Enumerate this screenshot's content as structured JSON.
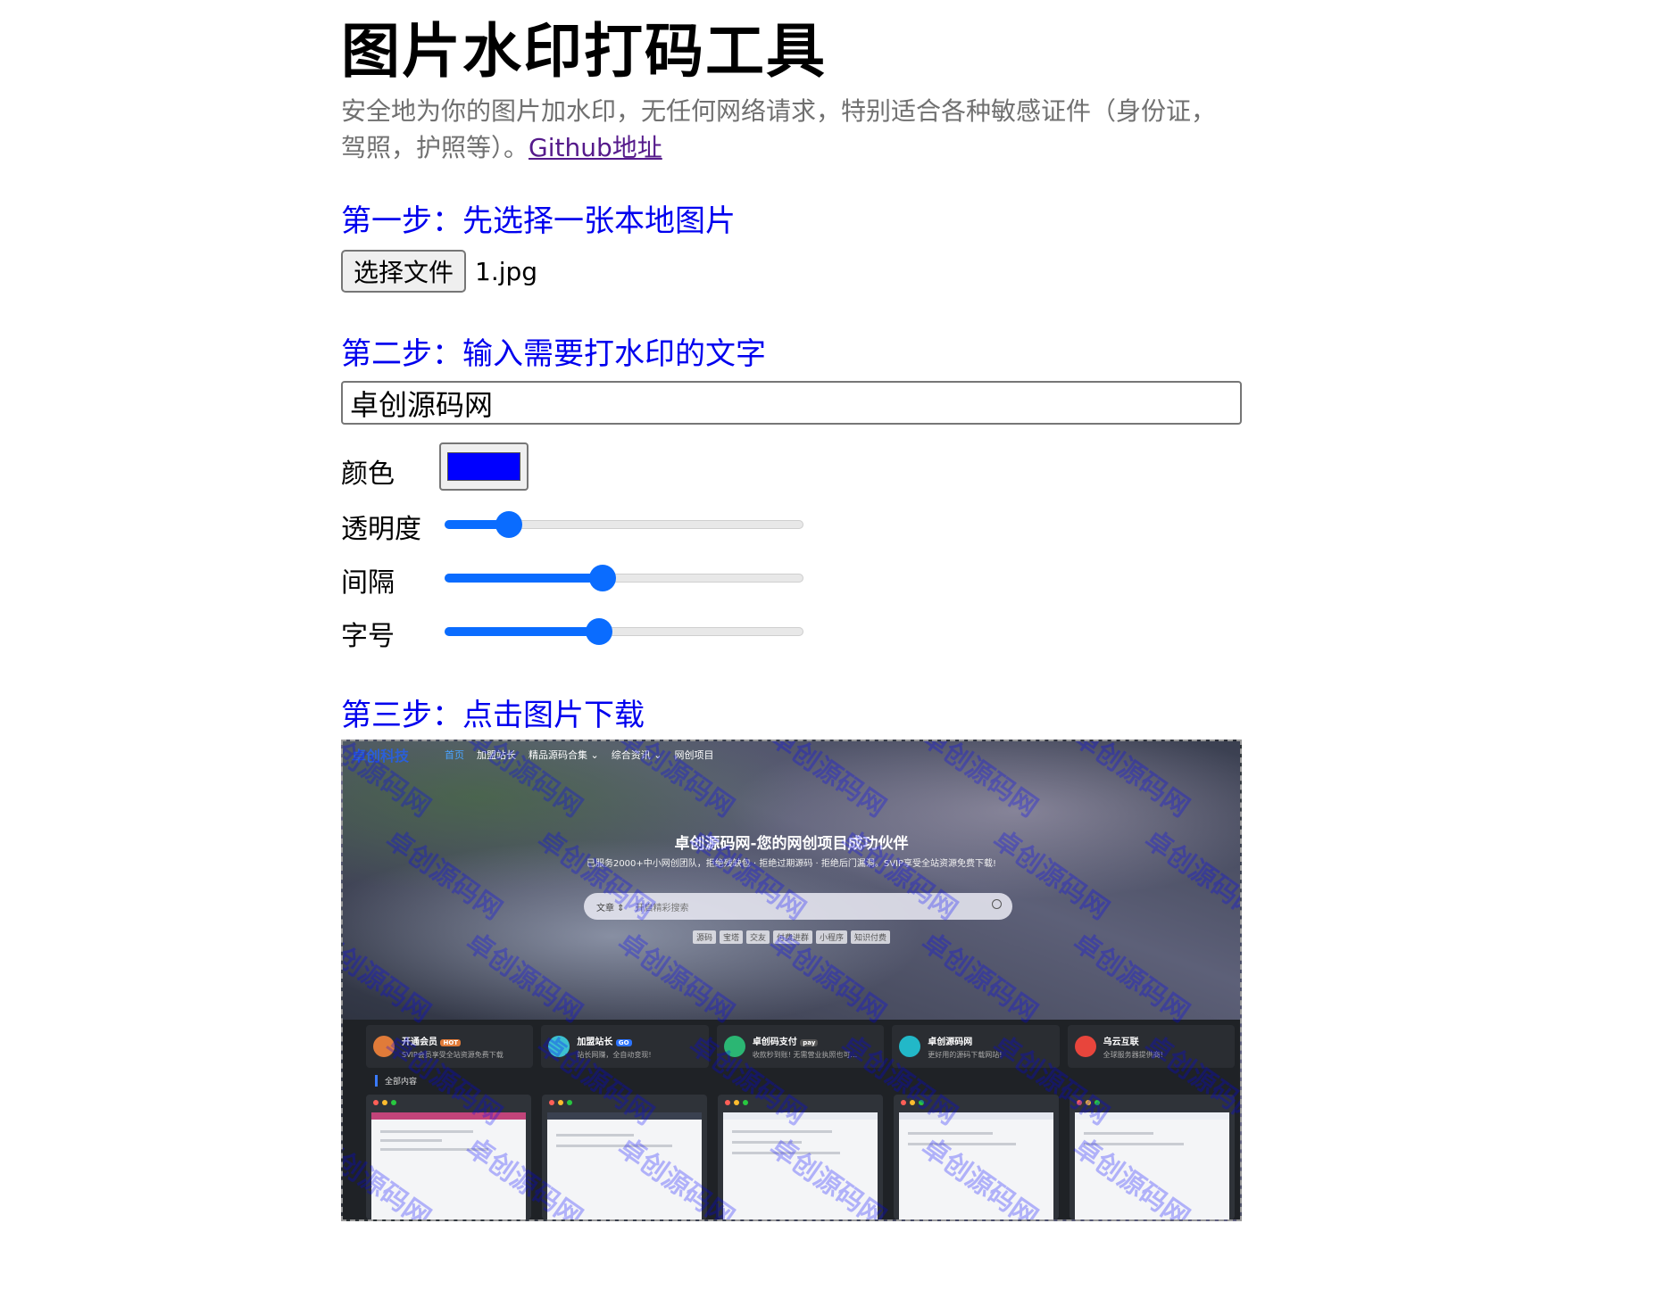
{
  "header": {
    "title": "图片水印打码工具",
    "description": "安全地为你的图片加水印，无任何网络请求，特别适合各种敏感证件（身份证，驾照，护照等）。",
    "github_link": "Github地址"
  },
  "step1": {
    "heading": "第一步：先选择一张本地图片",
    "choose_button": "选择文件",
    "file_name": "1.jpg"
  },
  "step2": {
    "heading": "第二步：输入需要打水印的文字",
    "watermark_text": "卓创源码网",
    "color_label": "颜色",
    "color_value": "#0000ff",
    "opacity_label": "透明度",
    "opacity_value": 0.18,
    "spacing_label": "间隔",
    "spacing_value": 0.44,
    "fontsize_label": "字号",
    "fontsize_value": 0.43
  },
  "step3": {
    "heading": "第三步：点击图片下载"
  },
  "preview": {
    "logo": "卓创科技",
    "nav": [
      "首页",
      "加盟站长",
      "精品源码合集 ⌄",
      "综合资讯 ⌄",
      "网创项目"
    ],
    "hero_title": "卓创源码网-您的网创项目成功伙伴",
    "hero_subtitle": "已服务2000+中小网创团队，拒绝残缺包 · 拒绝过期源码 · 拒绝后门漏洞。SVIP享受全站资源免费下载!",
    "search_select": "文章 ⇕",
    "search_placeholder": "开启精彩搜索",
    "tags": [
      "源码",
      "宝塔",
      "交友",
      "付费进群",
      "小程序",
      "知识付费"
    ],
    "cards": [
      {
        "title": "开通会员",
        "badge": "HOT",
        "sub": "SVIP会员享受全站资源免费下载",
        "color": "#e07b39"
      },
      {
        "title": "加盟站长",
        "badge": "GO",
        "sub": "站长网赚，全自动变现!",
        "color": "#3cc0d0"
      },
      {
        "title": "卓创码支付",
        "badge": "pay",
        "sub": "收款秒到账! 无需营业执照也可...",
        "color": "#2bb673"
      },
      {
        "title": "卓创源码网",
        "badge": "",
        "sub": "更好用的源码下载网站!",
        "color": "#22b8c8"
      },
      {
        "title": "乌云互联",
        "badge": "",
        "sub": "全球服务器提供商!",
        "color": "#e8453c"
      }
    ],
    "section_label": "全部内容"
  }
}
